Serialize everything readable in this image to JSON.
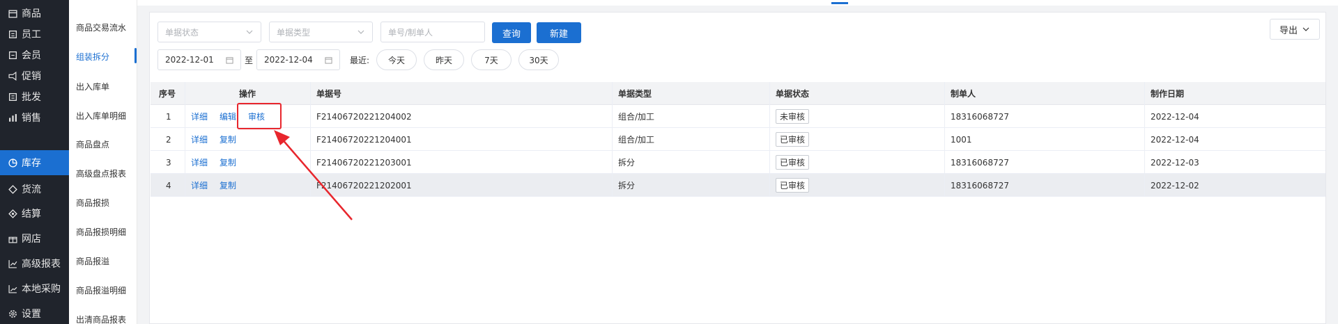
{
  "nav": {
    "items": [
      {
        "label": "商品",
        "icon": "store-icon"
      },
      {
        "label": "员工",
        "icon": "staff-icon"
      },
      {
        "label": "会员",
        "icon": "member-icon"
      },
      {
        "label": "促销",
        "icon": "megaphone-icon"
      },
      {
        "label": "批发",
        "icon": "wholesale-icon"
      },
      {
        "label": "销售",
        "icon": "bar-chart-icon"
      },
      {
        "label": "库存",
        "icon": "pie-chart-icon",
        "active": true
      },
      {
        "label": "货流",
        "icon": "flow-icon"
      },
      {
        "label": "结算",
        "icon": "settlement-icon"
      },
      {
        "label": "网店",
        "icon": "gift-icon"
      },
      {
        "label": "高级报表",
        "icon": "line-chart-icon"
      },
      {
        "label": "本地采购",
        "icon": "trend-icon"
      },
      {
        "label": "设置",
        "icon": "gear-icon"
      }
    ]
  },
  "submenu": {
    "items": [
      {
        "label": "商品交易流水"
      },
      {
        "label": "组装拆分",
        "active": true
      },
      {
        "label": "出入库单"
      },
      {
        "label": "出入库单明细"
      },
      {
        "label": "商品盘点"
      },
      {
        "label": "高级盘点报表"
      },
      {
        "label": "商品报损"
      },
      {
        "label": "商品报损明细"
      },
      {
        "label": "商品报溢"
      },
      {
        "label": "商品报溢明细"
      },
      {
        "label": "出清商品报表"
      }
    ]
  },
  "filters": {
    "status_placeholder": "单据状态",
    "type_placeholder": "单据类型",
    "number_placeholder": "单号/制单人",
    "query_label": "查询",
    "new_label": "新建",
    "export_label": "导出",
    "date_from": "2022-12-01",
    "date_to": "2022-12-04",
    "to_label": "至",
    "recent_label": "最近:",
    "quick": [
      "今天",
      "昨天",
      "7天",
      "30天"
    ]
  },
  "table": {
    "headers": {
      "index": "序号",
      "actions": "操作",
      "doc_no": "单据号",
      "doc_type": "单据类型",
      "doc_status": "单据状态",
      "creator": "制单人",
      "date": "制作日期"
    },
    "rows": [
      {
        "index": "1",
        "actions": [
          "详细",
          "编辑",
          "审核"
        ],
        "doc_no": "F21406720221204002",
        "doc_type": "组合/加工",
        "doc_status": "未审核",
        "creator": "18316068727",
        "date": "2022-12-04"
      },
      {
        "index": "2",
        "actions": [
          "详细",
          "复制"
        ],
        "doc_no": "F21406720221204001",
        "doc_type": "组合/加工",
        "doc_status": "已审核",
        "creator": "1001",
        "date": "2022-12-04"
      },
      {
        "index": "3",
        "actions": [
          "详细",
          "复制"
        ],
        "doc_no": "F21406720221203001",
        "doc_type": "拆分",
        "doc_status": "已审核",
        "creator": "18316068727",
        "date": "2022-12-03"
      },
      {
        "index": "4",
        "actions": [
          "详细",
          "复制"
        ],
        "doc_no": "F21406720221202001",
        "doc_type": "拆分",
        "doc_status": "已审核",
        "creator": "18316068727",
        "date": "2022-12-02"
      }
    ]
  },
  "colors": {
    "primary": "#1b6fd1",
    "nav_bg": "#20242c",
    "annotation": "#e8262d"
  }
}
